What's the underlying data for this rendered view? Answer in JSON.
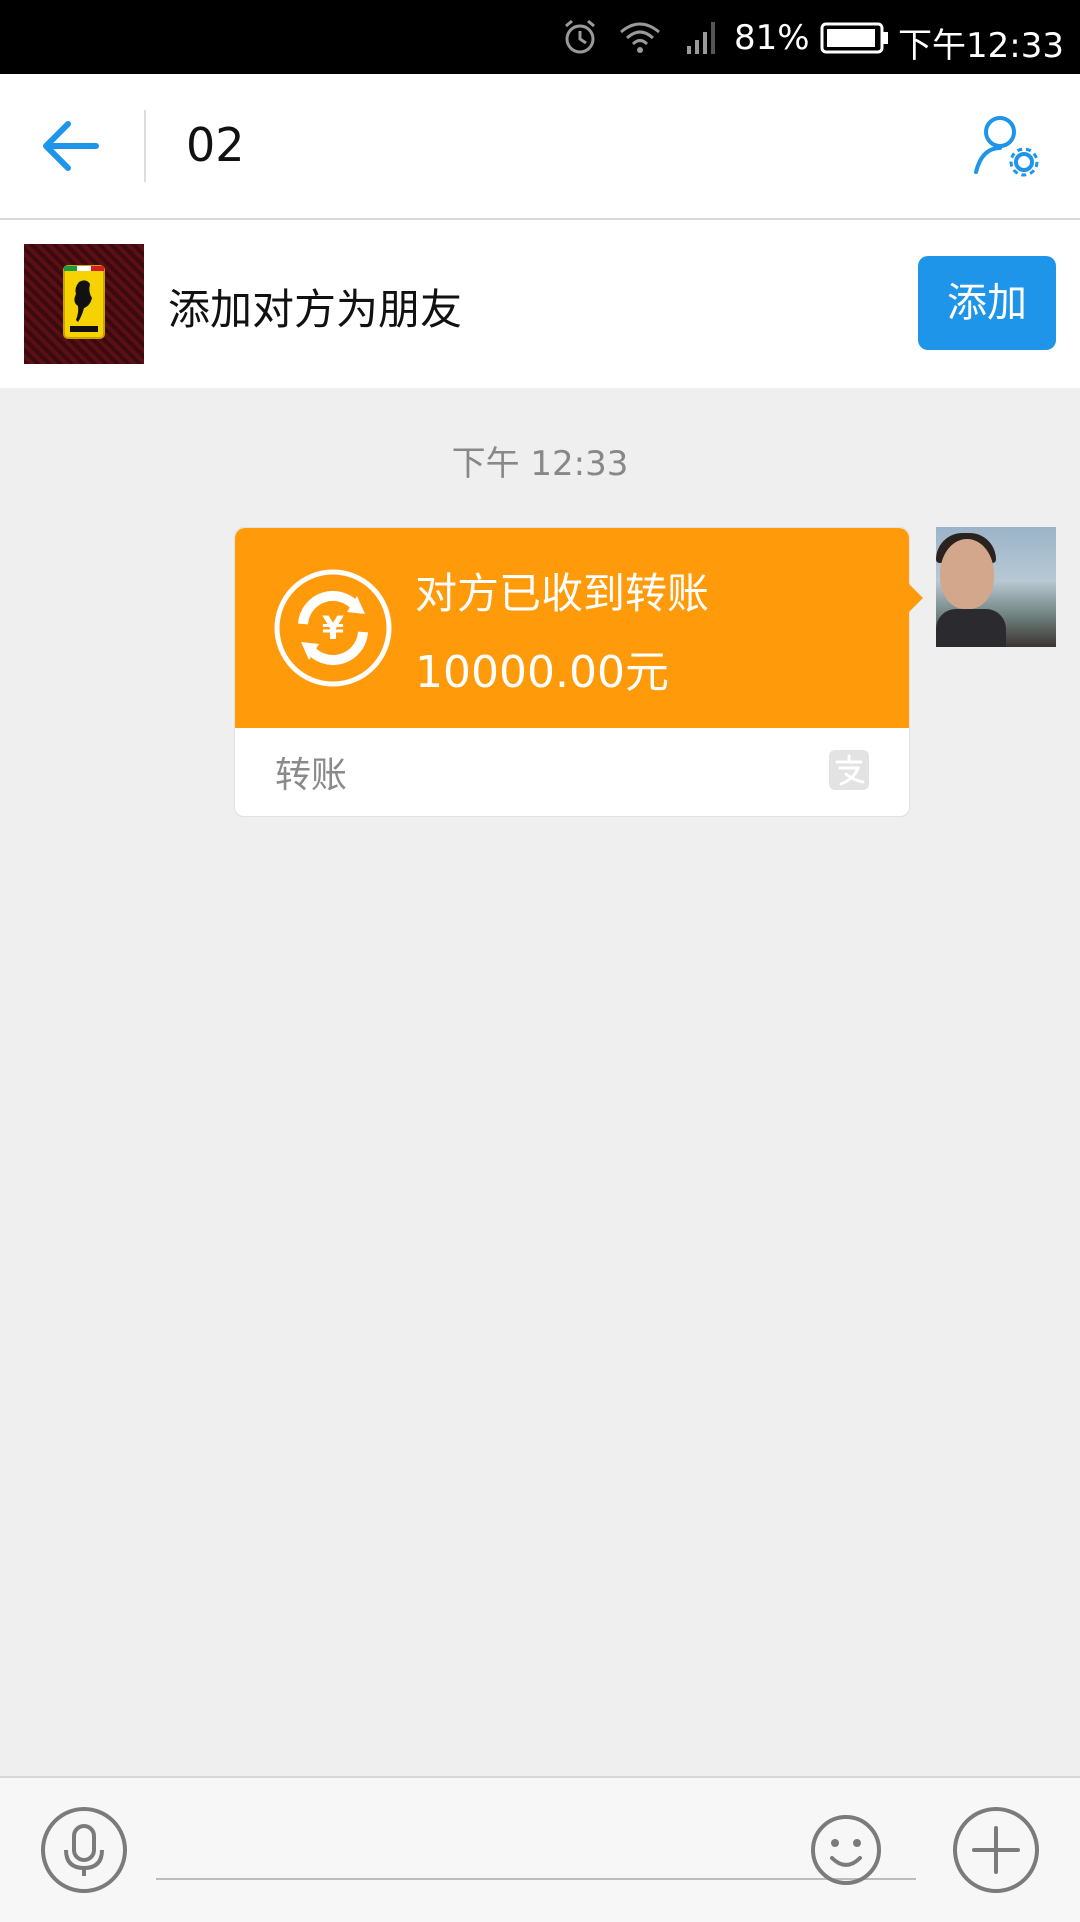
{
  "status_bar": {
    "battery_percent": "81%",
    "time": "下午12:33",
    "icons": [
      "alarm-icon",
      "wifi-icon",
      "signal-icon",
      "battery-icon"
    ]
  },
  "header": {
    "title": "02",
    "icons": [
      "back-arrow-icon",
      "profile-settings-icon"
    ],
    "accent_color": "#1f95ea"
  },
  "add_friend": {
    "label": "添加对方为朋友",
    "button_label": "添加"
  },
  "chat": {
    "timestamp": "下午 12:33",
    "transfer": {
      "status": "对方已收到转账",
      "amount": "10000.00元",
      "type_label": "转账",
      "card_color": "#ff9a0b"
    }
  },
  "input_bar": {
    "message_placeholder": "",
    "icons": [
      "microphone-icon",
      "emoji-icon",
      "plus-icon"
    ]
  }
}
